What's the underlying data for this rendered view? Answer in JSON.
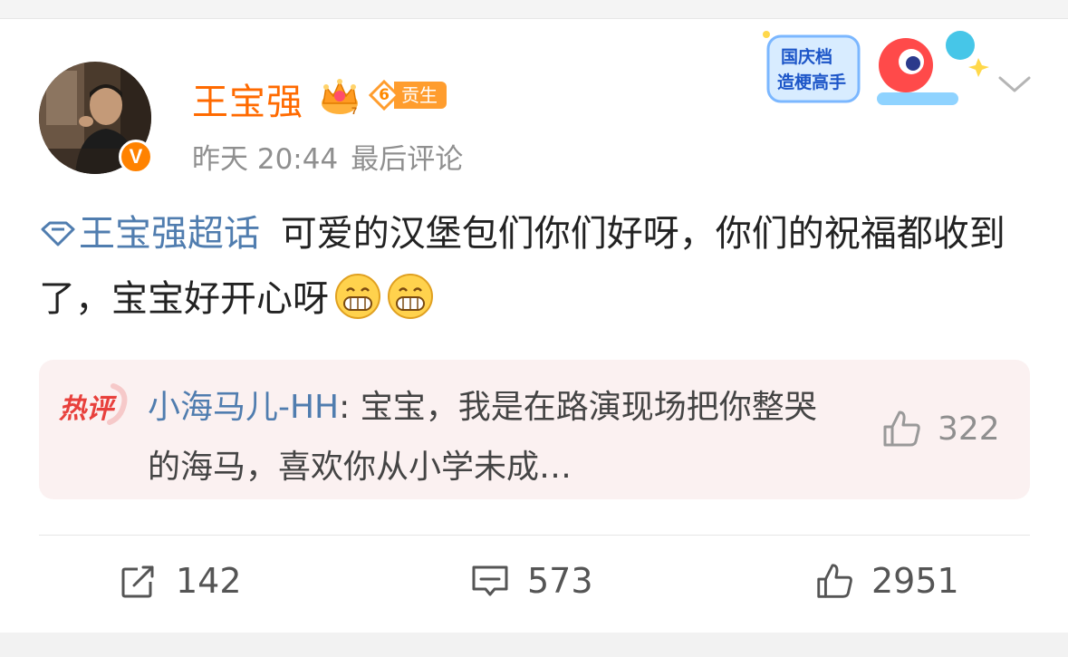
{
  "post": {
    "author": "王宝强",
    "level_number": "6",
    "level_label": "贡生",
    "time": "昨天 20:44",
    "last_comment_label": "最后评论",
    "topic": "王宝强超话",
    "text": "可爱的汉堡包们你们好呀，你们的祝福都收到了，宝宝好开心呀",
    "promo": {
      "line1": "国庆档",
      "line2": "造梗高手"
    }
  },
  "hot_comment": {
    "tag": "热评",
    "user": "小海马儿-HH",
    "text": "宝宝，我是在路演现场把你整哭的海马，喜欢你从小学未成…",
    "likes": "322"
  },
  "actions": {
    "repost": "142",
    "comment": "573",
    "like": "2951"
  },
  "colors": {
    "name": "#ff6a00",
    "link": "#507daf",
    "meta": "#8f8f8f",
    "hot_bg": "#fbf1f1",
    "hot_tag": "#e8403c"
  }
}
